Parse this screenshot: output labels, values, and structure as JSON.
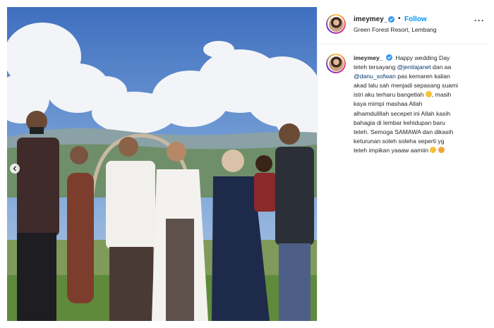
{
  "post": {
    "username": "imeymey_",
    "follow_label": "Follow",
    "separator": "•",
    "location": "Green Forest Resort, Lembang",
    "more_label": "···"
  },
  "caption": {
    "username": "imeymey_",
    "lines": [
      [
        "Happy wedding Day"
      ],
      [
        "teteh tersayang ",
        "@jenitajanet",
        " dan aa"
      ],
      [
        "@danu_sofwan",
        " pas kemaren kalian"
      ],
      [
        "akad lalu sah menjadi sepasang suami"
      ],
      [
        "istri aku terharu bangetlah",
        "",
        ", masih"
      ],
      [
        "kaya mimpi mashaa Allah"
      ],
      [
        "alhamdulillah secepet ini Allah kasih"
      ],
      [
        "bahagia di lembar kehidupan baru"
      ],
      [
        "teteh. Semoga SAMAWA dan dikasih"
      ],
      [
        "keturunan soleh soleha seperti yg"
      ],
      [
        "teteh impikan yaaaw aamiin",
        ""
      ]
    ],
    "emojis": [
      "crying-face-emoji",
      "grinning-face-emoji",
      "smiling-face-with-hearts-emoji"
    ]
  },
  "colors": {
    "accent": "#0095f6",
    "mention": "#00376b",
    "text": "#262626",
    "verified": "#3897f0"
  },
  "carousel": {
    "active_index": 1,
    "count": 3
  }
}
